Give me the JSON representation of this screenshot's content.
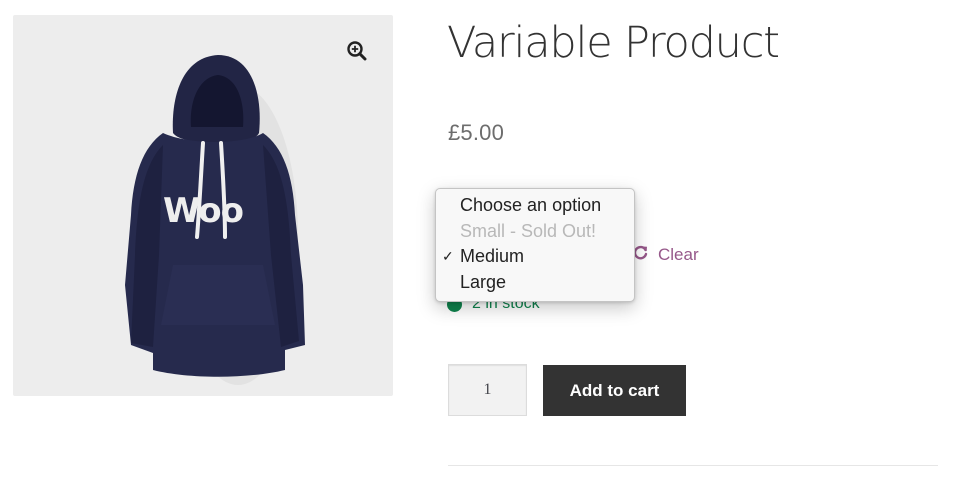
{
  "product": {
    "title": "Variable Product",
    "price": "£5.00",
    "image_logo_text": "WOO",
    "zoom_icon": "magnify-plus-icon"
  },
  "variations": {
    "clear_label": "Clear",
    "clear_icon": "refresh-icon",
    "options": [
      {
        "label": "Choose an option",
        "state": "normal"
      },
      {
        "label": "Small - Sold Out!",
        "state": "disabled"
      },
      {
        "label": "Medium",
        "state": "selected"
      },
      {
        "label": "Large",
        "state": "normal"
      }
    ],
    "selected": "Medium"
  },
  "stock": {
    "text": "2 in stock",
    "icon": "check-circle-icon",
    "color": "#0f834d"
  },
  "cart": {
    "quantity": "1",
    "add_label": "Add to cart"
  },
  "colors": {
    "accent": "#96588a",
    "button_bg": "#333333"
  }
}
